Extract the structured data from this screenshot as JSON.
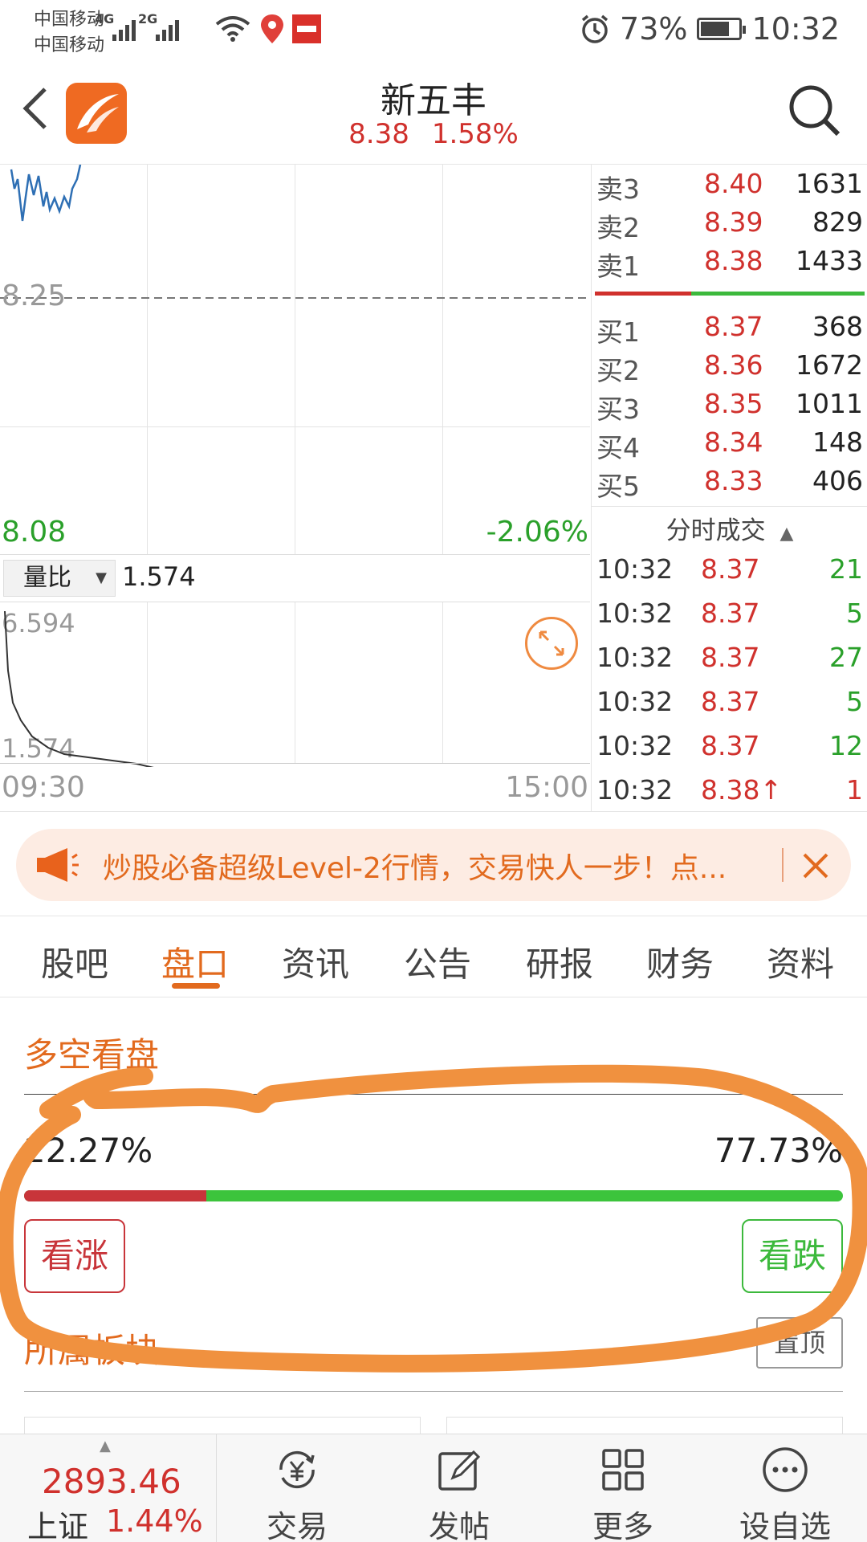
{
  "statusbar": {
    "carrier1": "中国移动",
    "carrier2": "中国移动",
    "net1": "4G",
    "net2": "2G",
    "battery": "73%",
    "time": "10:32"
  },
  "header": {
    "title": "新五丰",
    "price": "8.38",
    "change_pct": "1.58%"
  },
  "chart": {
    "ref_price": "8.25",
    "low_price": "8.08",
    "low_pct": "-2.06%",
    "ratio_label": "量比",
    "ratio_value": "1.574",
    "ratio_high": "6.594",
    "ratio_low": "1.574",
    "time_start": "09:30",
    "time_end": "15:00"
  },
  "order_book": {
    "asks": [
      {
        "label": "卖3",
        "price": "8.40",
        "volume": "1631"
      },
      {
        "label": "卖2",
        "price": "8.39",
        "volume": "829"
      },
      {
        "label": "卖1",
        "price": "8.38",
        "volume": "1433"
      }
    ],
    "bids": [
      {
        "label": "买1",
        "price": "8.37",
        "volume": "368"
      },
      {
        "label": "买2",
        "price": "8.36",
        "volume": "1672"
      },
      {
        "label": "买3",
        "price": "8.35",
        "volume": "1011"
      },
      {
        "label": "买4",
        "price": "8.34",
        "volume": "148"
      },
      {
        "label": "买5",
        "price": "8.33",
        "volume": "406"
      }
    ]
  },
  "ticks": {
    "header": "分时成交",
    "rows": [
      {
        "time": "10:32",
        "price": "8.37",
        "volume": "21",
        "color": "#2aa02a"
      },
      {
        "time": "10:32",
        "price": "8.37",
        "volume": "5",
        "color": "#2aa02a"
      },
      {
        "time": "10:32",
        "price": "8.37",
        "volume": "27",
        "color": "#2aa02a"
      },
      {
        "time": "10:32",
        "price": "8.37",
        "volume": "5",
        "color": "#2aa02a"
      },
      {
        "time": "10:32",
        "price": "8.37",
        "volume": "12",
        "color": "#2aa02a"
      },
      {
        "time": "10:32",
        "price": "8.38↑",
        "volume": "1",
        "color": "#d0312d"
      }
    ]
  },
  "banner": {
    "text": "炒股必备超级Level-2行情，交易快人一步！点..."
  },
  "tabs": [
    "股吧",
    "盘口",
    "资讯",
    "公告",
    "研报",
    "财务",
    "资料"
  ],
  "active_tab": "盘口",
  "sentiment": {
    "title": "多空看盘",
    "bull_pct": "22.27%",
    "bear_pct": "77.73%",
    "bull_fraction": 0.2227,
    "bull_button": "看涨",
    "bear_button": "看跌"
  },
  "sectors": {
    "title": "所属板块",
    "pin_button": "置顶"
  },
  "bottom_nav": {
    "index_value": "2893.46",
    "index_name": "上证",
    "index_change": "1.44%",
    "items": [
      {
        "label": "交易",
        "icon": "yuan-cycle-icon"
      },
      {
        "label": "发帖",
        "icon": "edit-icon"
      },
      {
        "label": "更多",
        "icon": "grid-icon"
      },
      {
        "label": "设自选",
        "icon": "more-dots-icon"
      }
    ]
  },
  "colors": {
    "up": "#d0312d",
    "down": "#2aa02a",
    "accent": "#e26a1e",
    "annotation": "#f0913f"
  }
}
